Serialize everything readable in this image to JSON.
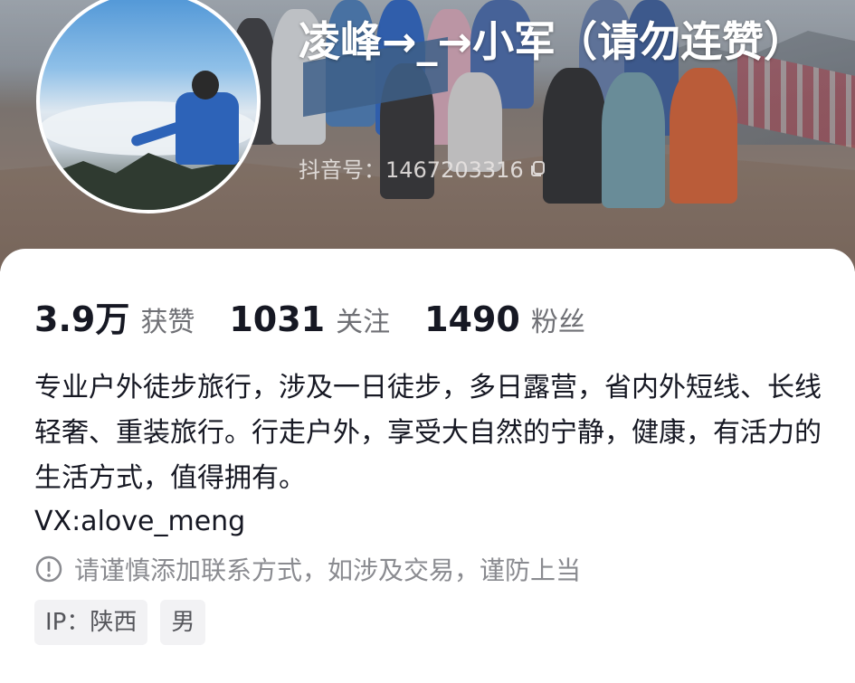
{
  "profile": {
    "name": "凌峰→_→小军（请勿连赞）",
    "douyin_id": "抖音号：1467203316"
  },
  "stats": [
    {
      "value": "3.9万",
      "label": "获赞"
    },
    {
      "value": "1031",
      "label": "关注"
    },
    {
      "value": "1490",
      "label": "粉丝"
    }
  ],
  "bio": "专业户外徒步旅行，涉及一日徒步，多日露营，省内外短线、长线轻奢、重装旅行。行走户外，享受大自然的宁静，健康，有活力的生活方式，值得拥有。",
  "contact": "VX:alove_meng",
  "warning": "请谨慎添加联系方式，如涉及交易，谨防上当",
  "tags": [
    "IP：陕西",
    "男"
  ],
  "icons": {
    "copy": "copy-icon",
    "info": "info-icon"
  },
  "colors": {
    "primary_text": "#161823",
    "secondary_text": "#8a8b90",
    "tag_bg": "#f2f2f4"
  }
}
